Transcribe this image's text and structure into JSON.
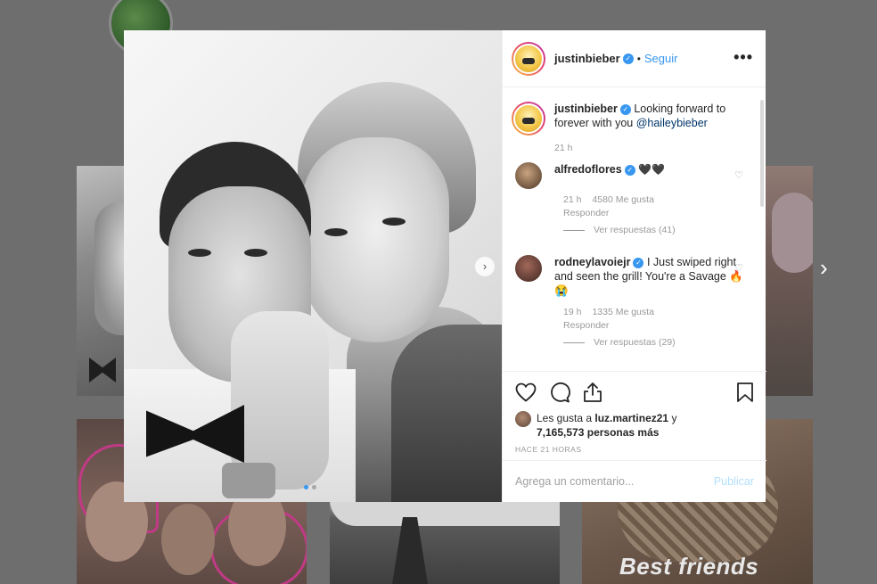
{
  "post": {
    "username": "justinbieber",
    "follow_label": "Seguir",
    "bullet": "•",
    "more_label": "•••"
  },
  "caption": {
    "username": "justinbieber",
    "text_before": "Looking forward to forever with you",
    "mention": "@haileybieber",
    "time": "21 h"
  },
  "comments": [
    {
      "username": "alfredoflores",
      "text": "🖤🖤",
      "time": "21 h",
      "likes": "4580 Me gusta",
      "reply_label": "Responder",
      "view_replies": "Ver respuestas (41)"
    },
    {
      "username": "rodneylavoiejr",
      "text": "I Just swiped right and seen the grill! You're a Savage 🔥😭",
      "time": "19 h",
      "likes": "1335 Me gusta",
      "reply_label": "Responder",
      "view_replies": "Ver respuestas (29)"
    }
  ],
  "likes": {
    "prefix": "Les gusta a",
    "user": "luz.martinez21",
    "joiner": "y",
    "count": "7,165,573",
    "suffix": "personas más"
  },
  "timestamp": "HACE 21 HORAS",
  "comment_box": {
    "placeholder": "Agrega un comentario...",
    "publish_label": "Publicar"
  },
  "background": {
    "tile_caption": "Best friends",
    "next_arrow": "›"
  },
  "colors": {
    "accent": "#3897f0",
    "overlay": "#6e6e6e",
    "publish_disabled": "#b2dffc"
  },
  "icons": [
    "heart-icon",
    "comment-icon",
    "share-icon",
    "bookmark-icon",
    "verified-icon",
    "more-options-icon",
    "chevron-right-icon"
  ]
}
